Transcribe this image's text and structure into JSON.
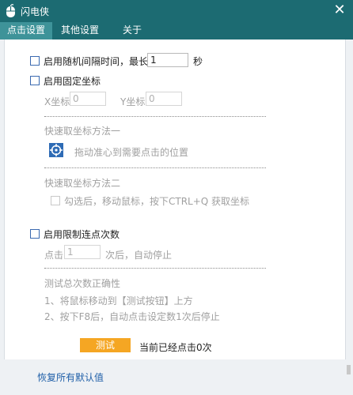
{
  "window": {
    "title": "闪电侠"
  },
  "tabs": [
    {
      "label": "点击设置",
      "active": true
    },
    {
      "label": "其他设置",
      "active": false
    },
    {
      "label": "关于",
      "active": false
    }
  ],
  "random_interval": {
    "label": "启用随机间隔时间，最长为",
    "value": "1",
    "unit": "秒",
    "checked": false
  },
  "fixed_coord": {
    "label": "启用固定坐标",
    "checked": false,
    "x_label": "X坐标",
    "x_value": "0",
    "y_label": "Y坐标",
    "y_value": "0",
    "method1_title": "快速取坐标方法一",
    "method1_hint": "拖动准心到需要点击的位置",
    "method2_title": "快速取坐标方法二",
    "method2_hint": "勾选后，移动鼠标，按下CTRL+Q 获取坐标",
    "method2_checked": false
  },
  "limit_clicks": {
    "label": "启用限制连点次数",
    "checked": false,
    "prefix": "点击",
    "value": "1",
    "suffix": "次后，自动停止"
  },
  "test": {
    "title": "测试总次数正确性",
    "step1": "1、将鼠标移动到【测试按钮】上方",
    "step2": "2、按下F8后，自动点击设定数1次后停止",
    "button_label": "测试",
    "status": "当前已经点击0次"
  },
  "footer": {
    "reset_label": "恢复所有默认值"
  },
  "colors": {
    "titlebar": "#1c6b72",
    "active_tab": "#3e9399",
    "test_button": "#f5a623",
    "link": "#1f5fa8"
  }
}
